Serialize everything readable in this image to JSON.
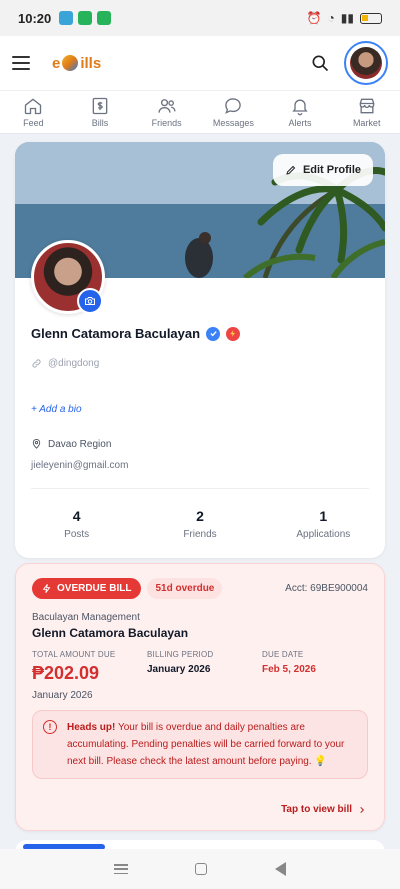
{
  "status_bar": {
    "time": "10:20",
    "battery_icon": "battery-icon",
    "wifi_icon": "wifi-icon"
  },
  "app": {
    "logo_text_prefix": "e",
    "logo_text_suffix": "ills",
    "menu_icon": "hamburger-icon",
    "search_icon": "search-icon"
  },
  "nav": {
    "items": [
      {
        "label": "Feed",
        "icon": "home-icon"
      },
      {
        "label": "Bills",
        "icon": "bill-icon"
      },
      {
        "label": "Friends",
        "icon": "friends-icon"
      },
      {
        "label": "Messages",
        "icon": "chat-icon"
      },
      {
        "label": "Alerts",
        "icon": "bell-icon"
      },
      {
        "label": "Market",
        "icon": "store-icon"
      }
    ]
  },
  "profile": {
    "edit_label": "Edit Profile",
    "name": "Glenn Catamora Baculayan",
    "handle": "@dingdong",
    "add_bio": "+ Add a bio",
    "location": "Davao Region",
    "email": "jieleyenin@gmail.com",
    "stats": [
      {
        "value": "4",
        "label": "Posts"
      },
      {
        "value": "2",
        "label": "Friends"
      },
      {
        "value": "1",
        "label": "Applications"
      }
    ]
  },
  "bill": {
    "status_label": "OVERDUE BILL",
    "days_overdue": "51d overdue",
    "account": "Acct: 69BE900004",
    "biller": "Baculayan Management",
    "customer": "Glenn Catamora Baculayan",
    "total_caption": "TOTAL AMOUNT DUE",
    "total_amount": "₱202.09",
    "total_period": "January 2026",
    "period_caption": "BILLING PERIOD",
    "period_value": "January 2026",
    "due_caption": "DUE DATE",
    "due_value": "Feb 5, 2026",
    "alert_title": "Heads up!",
    "alert_text": " Your bill is overdue and daily penalties are accumulating. Pending penalties will be carried forward to your next bill. Please check the latest amount before paying. 💡",
    "view_label": "Tap to view bill",
    "colors": {
      "overdue": "#e53935",
      "amount": "#d32f2f"
    }
  }
}
